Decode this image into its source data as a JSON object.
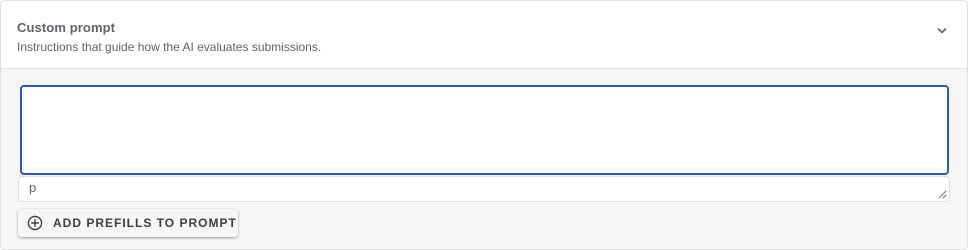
{
  "header": {
    "title": "Custom prompt",
    "description": "Instructions that guide how the AI evaluates submissions.",
    "toggle_icon": "chevron-down-icon"
  },
  "editor": {
    "prompt_value": "",
    "footer_tag": "p",
    "accent_color": "#2859c5"
  },
  "actions": {
    "add_prefills_label": "ADD PREFILLS TO PROMPT",
    "add_prefills_icon": "add-circle-icon"
  }
}
